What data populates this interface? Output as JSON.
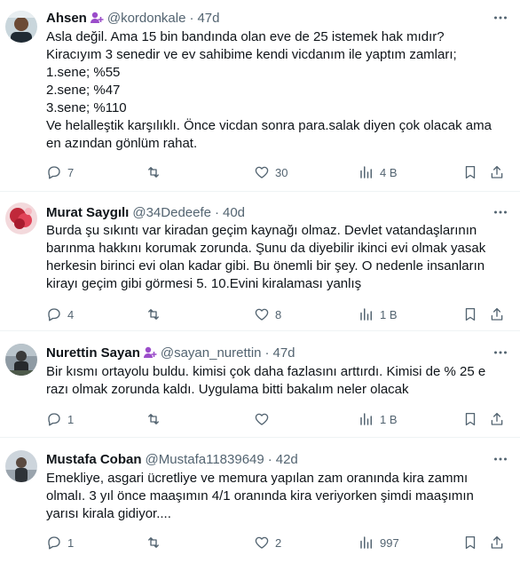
{
  "colors": {
    "text": "#0f1419",
    "secondary": "#536471",
    "divider": "#eff3f4",
    "badge": "#9b4dca"
  },
  "tweets": [
    {
      "name": "Ahsen",
      "handle": "@kordonkale",
      "sep": "·",
      "time": "47d",
      "has_badge": true,
      "lines": [
        "Asla değil. Ama 15 bin bandında olan eve de 25 istemek hak mıdır?",
        "Kiracıyım 3 senedir ve ev sahibime kendi vicdanım ile yaptım zamları;",
        "1.sene; %55",
        "2.sene; %47",
        "3.sene; %110",
        "Ve helalleştik karşılıklı. Önce vicdan sonra para.salak diyen çok olacak ama",
        "en azından gönlüm rahat."
      ],
      "replies": "7",
      "retweets": "",
      "likes": "30",
      "views": "4 B"
    },
    {
      "name": "Murat Saygılı",
      "handle": "@34Dedeefe",
      "sep": "·",
      "time": "40d",
      "has_badge": false,
      "lines": [
        "Burda şu sıkıntı var kiradan geçim kaynağı olmaz. Devlet vatandaşlarının",
        "barınma hakkını korumak zorunda. Şunu da diyebilir ikinci evi olmak yasak",
        "herkesin birinci evi olan kadar gibi. Bu önemli bir şey. O nedenle insanların",
        "kirayı geçim gibi görmesi 5. 10.Evini kiralaması yanlış"
      ],
      "replies": "4",
      "retweets": "",
      "likes": "8",
      "views": "1 B"
    },
    {
      "name": "Nurettin Sayan",
      "handle": "@sayan_nurettin",
      "sep": "·",
      "time": "47d",
      "has_badge": true,
      "lines": [
        "Bir kısmı ortayolu buldu.  kimisi çok daha fazlasını arttırdı. Kimisi de % 25 e",
        "razı olmak zorunda kaldı. Uygulama bitti bakalım neler olacak"
      ],
      "replies": "1",
      "retweets": "",
      "likes": "",
      "views": "1 B"
    },
    {
      "name": "Mustafa Coban",
      "handle": "@Mustafa11839649",
      "sep": "·",
      "time": "42d",
      "has_badge": false,
      "lines": [
        "Emekliye, asgari ücretliye ve memura yapılan zam oranında kira zammı",
        "olmalı. 3 yıl önce maaşımın 4/1 oranında kira veriyorken şimdi maaşımın",
        "yarısı kirala gidiyor...."
      ],
      "replies": "1",
      "retweets": "",
      "likes": "2",
      "views": "997"
    }
  ]
}
